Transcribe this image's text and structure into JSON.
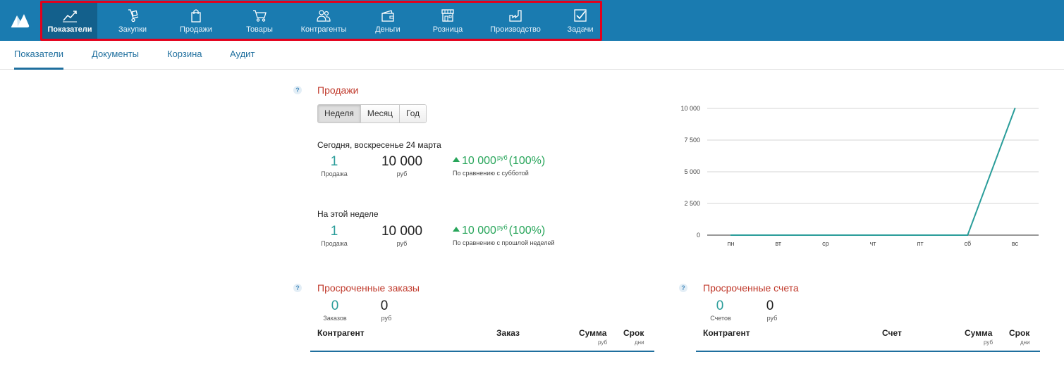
{
  "nav": {
    "items": [
      {
        "label": "Показатели",
        "icon": "line-chart-icon",
        "active": true
      },
      {
        "label": "Закупки",
        "icon": "hand-truck-icon",
        "active": false
      },
      {
        "label": "Продажи",
        "icon": "shopping-bag-icon",
        "active": false
      },
      {
        "label": "Товары",
        "icon": "shopping-cart-icon",
        "active": false
      },
      {
        "label": "Контрагенты",
        "icon": "people-icon",
        "active": false
      },
      {
        "label": "Деньги",
        "icon": "wallet-icon",
        "active": false
      },
      {
        "label": "Розница",
        "icon": "store-icon",
        "active": false
      },
      {
        "label": "Производство",
        "icon": "factory-icon",
        "active": false
      },
      {
        "label": "Задачи",
        "icon": "checkbox-icon",
        "active": false
      }
    ]
  },
  "subtabs": [
    "Показатели",
    "Документы",
    "Корзина",
    "Аудит"
  ],
  "sales": {
    "title": "Продажи",
    "periods": [
      "Неделя",
      "Месяц",
      "Год"
    ],
    "active_period": "Неделя",
    "today": {
      "label": "Сегодня, воскресенье 24 марта",
      "count": "1",
      "count_label": "Продажа",
      "amount": "10 000",
      "amount_unit": "руб",
      "delta": "10 000",
      "delta_unit": "руб",
      "delta_pct": "(100%)",
      "comparison": "По сравнению с субботой"
    },
    "week": {
      "label": "На этой неделе",
      "count": "1",
      "count_label": "Продажа",
      "amount": "10 000",
      "amount_unit": "руб",
      "delta": "10 000",
      "delta_unit": "руб",
      "delta_pct": "(100%)",
      "comparison": "По сравнению с прошлой неделей"
    }
  },
  "chart_data": {
    "type": "line",
    "categories": [
      "пн",
      "вт",
      "ср",
      "чт",
      "пт",
      "сб",
      "вс"
    ],
    "values": [
      0,
      0,
      0,
      0,
      0,
      0,
      10000
    ],
    "yticks": [
      0,
      2500,
      5000,
      7500,
      10000
    ],
    "ytick_labels": [
      "0",
      "2 500",
      "5 000",
      "7 500",
      "10 000"
    ],
    "ylim": [
      0,
      10000
    ],
    "grid": true,
    "color": "#2a9d9a"
  },
  "overdue_orders": {
    "title": "Просроченные заказы",
    "count": "0",
    "count_label": "Заказов",
    "amount": "0",
    "amount_unit": "руб",
    "columns": {
      "counterparty": "Контрагент",
      "doc": "Заказ",
      "sum": "Сумма",
      "sum_unit": "руб",
      "term": "Срок",
      "term_unit": "дни"
    }
  },
  "overdue_invoices": {
    "title": "Просроченные счета",
    "count": "0",
    "count_label": "Счетов",
    "amount": "0",
    "amount_unit": "руб",
    "columns": {
      "counterparty": "Контрагент",
      "doc": "Счет",
      "sum": "Сумма",
      "sum_unit": "руб",
      "term": "Срок",
      "term_unit": "дни"
    }
  },
  "help_mark": "?"
}
